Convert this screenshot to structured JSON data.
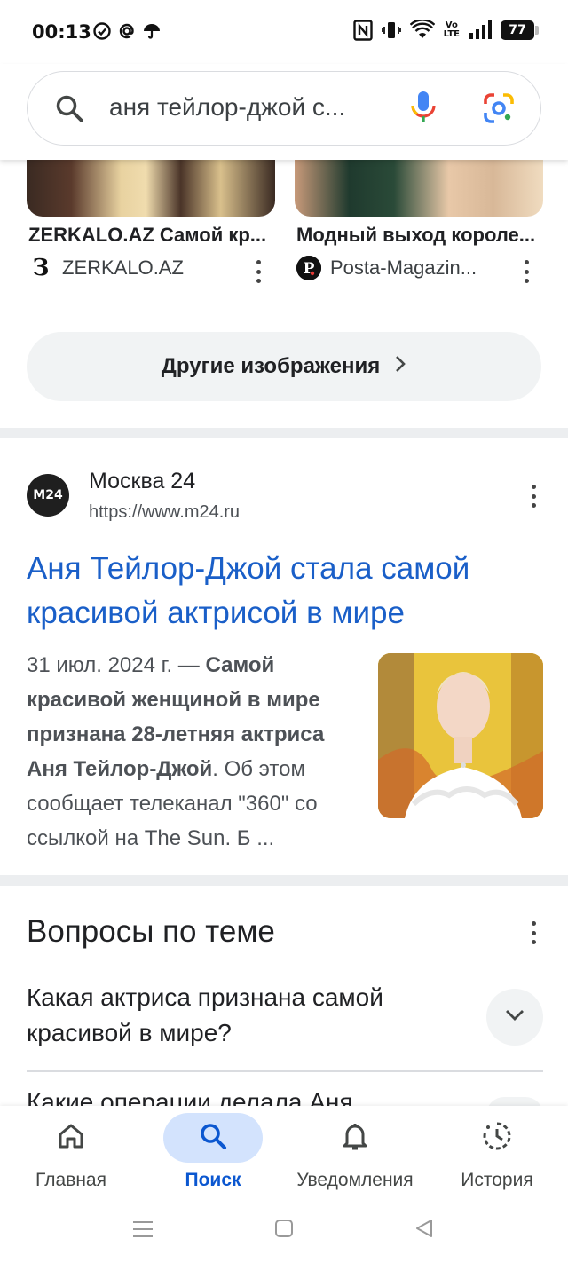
{
  "status_bar": {
    "time": "00:13",
    "battery": "77",
    "volte_top": "Vo",
    "volte_bottom": "LTE"
  },
  "search": {
    "query": "аня тейлор-джой с..."
  },
  "image_results": [
    {
      "title": "ZERKALO.AZ Самой кр...",
      "source": "ZERKALO.AZ",
      "logo_letter": "З"
    },
    {
      "title": "Модный выход короле...",
      "source": "Posta-Magazin...",
      "logo_letter": "P"
    }
  ],
  "more_images_label": "Другие изображения",
  "result": {
    "logo_text": "M24",
    "site_name": "Москва 24",
    "url": "https://www.m24.ru",
    "title": "Аня Тейлор-Джой стала самой красивой актрисой в мире",
    "snippet_date": "31 июл. 2024 г. — ",
    "snippet_bold_1": "Самой красивой женщиной в мире признана 28-летняя актриса Аня Тейлор-Джой",
    "snippet_rest": ". Об этом сообщает телеканал \"360\" со ссылкой на The Sun. Б ..."
  },
  "questions": {
    "heading": "Вопросы по теме",
    "items": [
      "Какая актриса признана самой красивой в мире?",
      "Какие операции делала Аня"
    ]
  },
  "bottom_nav": [
    {
      "label": "Главная",
      "icon": "home-icon",
      "active": false
    },
    {
      "label": "Поиск",
      "icon": "search-icon",
      "active": true
    },
    {
      "label": "Уведомления",
      "icon": "bell-icon",
      "active": false
    },
    {
      "label": "История",
      "icon": "history-icon",
      "active": false
    }
  ],
  "colors": {
    "link": "#1a5fc8",
    "active_nav": "#0b57d0",
    "active_pill": "#d3e3fd"
  }
}
